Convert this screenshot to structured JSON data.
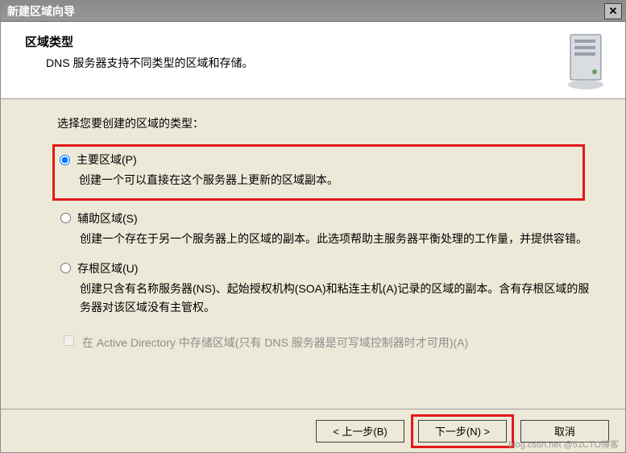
{
  "titlebar": {
    "title": "新建区域向导",
    "close": "✕"
  },
  "header": {
    "title": "区域类型",
    "subtitle": "DNS 服务器支持不同类型的区域和存储。"
  },
  "body": {
    "prompt": "选择您要创建的区域的类型：",
    "options": {
      "primary": {
        "label": "主要区域(P)",
        "desc": "创建一个可以直接在这个服务器上更新的区域副本。"
      },
      "secondary": {
        "label": "辅助区域(S)",
        "desc": "创建一个存在于另一个服务器上的区域的副本。此选项帮助主服务器平衡处理的工作量，并提供容错。"
      },
      "stub": {
        "label": "存根区域(U)",
        "desc": "创建只含有名称服务器(NS)、起始授权机构(SOA)和粘连主机(A)记录的区域的副本。含有存根区域的服务器对该区域没有主管权。"
      }
    },
    "ad_checkbox": "在 Active Directory 中存储区域(只有 DNS 服务器是可写域控制器时才可用)(A)"
  },
  "footer": {
    "back": "< 上一步(B)",
    "next": "下一步(N) >",
    "cancel": "取消"
  },
  "watermark": "blog.csdn.net @51CTO博客"
}
